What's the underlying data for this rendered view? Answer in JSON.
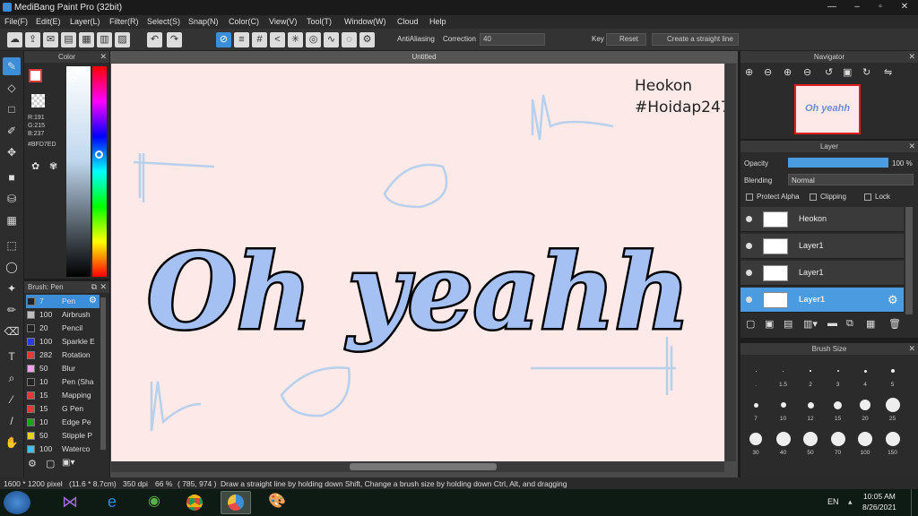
{
  "window": {
    "title": "MediBang Paint Pro (32bit)"
  },
  "menu": [
    "File(F)",
    "Edit(E)",
    "Layer(L)",
    "Filter(R)",
    "Select(S)",
    "Snap(N)",
    "Color(C)",
    "View(V)",
    "Tool(T)",
    "Window(W)",
    "Cloud",
    "Help"
  ],
  "toolbar": {
    "antialiasing_label": "AntiAliasing",
    "correction_label": "Correction",
    "correction_value": "40",
    "key_label": "Key",
    "reset_label": "Reset",
    "straight_line_label": "Create a straight line"
  },
  "color_panel": {
    "title": "Color",
    "r": "R:191",
    "g": "G:215",
    "b": "B:237",
    "hex": "#BFD7ED",
    "primary": "#bfd7ed"
  },
  "brush_panel": {
    "title": "Brush: Pen",
    "items": [
      {
        "size": "7",
        "name": "Pen",
        "color": "#222222"
      },
      {
        "size": "100",
        "name": "Airbrush",
        "color": "#bdbdbd"
      },
      {
        "size": "20",
        "name": "Pencil",
        "color": "#222222"
      },
      {
        "size": "100",
        "name": "Sparkle E",
        "color": "#2a3be0"
      },
      {
        "size": "282",
        "name": "Rotation",
        "color": "#e03a3a"
      },
      {
        "size": "50",
        "name": "Blur",
        "color": "#f0a0f0"
      },
      {
        "size": "10",
        "name": "Pen (Sha",
        "color": "#222222"
      },
      {
        "size": "15",
        "name": "Mapping",
        "color": "#e03a3a"
      },
      {
        "size": "15",
        "name": "G Pen",
        "color": "#e03a3a"
      },
      {
        "size": "10",
        "name": "Edge Pe",
        "color": "#20a020"
      },
      {
        "size": "50",
        "name": "Stipple P",
        "color": "#e8d020"
      },
      {
        "size": "100",
        "name": "Waterco",
        "color": "#40c0f0"
      }
    ]
  },
  "document": {
    "tab": "Untitled",
    "text_line1": "Heokon",
    "text_line2": "#Hoidap247",
    "lettering": "Oh yeahh"
  },
  "navigator": {
    "title": "Navigator"
  },
  "layer_panel": {
    "title": "Layer",
    "opacity_label": "Opacity",
    "opacity_value": "100 %",
    "opacity_fraction": 1.0,
    "blending_label": "Blending",
    "blending_value": "Normal",
    "protect_alpha": "Protect Alpha",
    "clipping": "Clipping",
    "lock": "Lock",
    "layers": [
      {
        "name": "Heokon",
        "selected": false
      },
      {
        "name": "Layer1",
        "selected": false
      },
      {
        "name": "Layer1",
        "selected": false
      },
      {
        "name": "Layer1",
        "selected": true
      }
    ]
  },
  "brush_size": {
    "title": "Brush Size",
    "sizes": [
      ".",
      "1.5",
      "2",
      "3",
      "4",
      "5",
      "7",
      "10",
      "12",
      "15",
      "20",
      "25",
      "30",
      "40",
      "50",
      "70",
      "100",
      "150"
    ]
  },
  "status": {
    "size": "1600 * 1200 pixel",
    "physical": "(11.6 * 8.7cm)",
    "dpi": "350 dpi",
    "zoom": "66 %",
    "coords": "( 785, 974 )",
    "hint": "Draw a straight line by holding down Shift, Change a brush size by holding down Ctrl, Alt, and dragging"
  },
  "taskbar": {
    "lang": "EN",
    "time": "10:05 AM",
    "date": "8/26/2021"
  }
}
